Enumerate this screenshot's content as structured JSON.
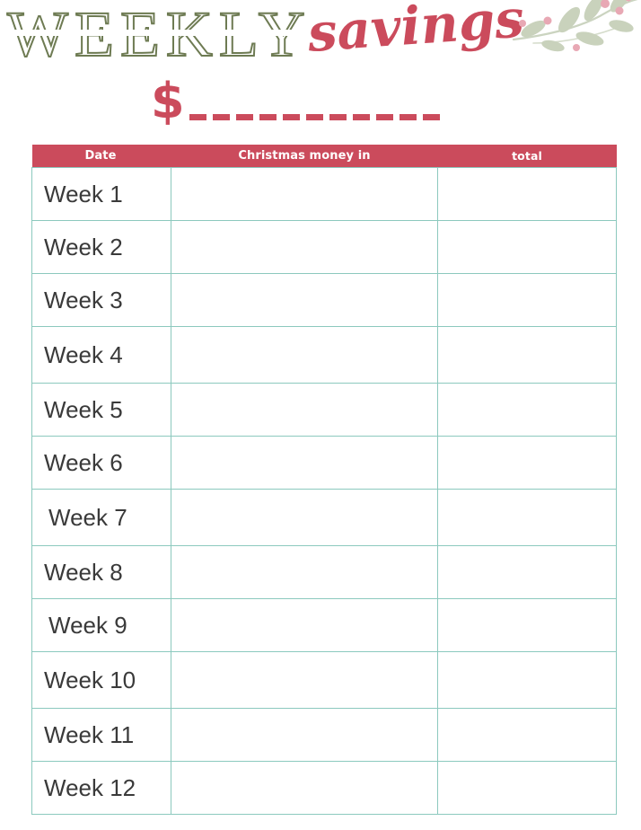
{
  "page": {
    "title_primary": "WEEKLY",
    "title_script": "savings",
    "currency_symbol": "$",
    "amount_blank_dashes": 11
  },
  "decoration": {
    "name": "botanical-branch",
    "leaf_color": "#C9D2BC",
    "stem_color": "#CBD4C0",
    "berry_color": "#E8A8B4"
  },
  "colors": {
    "accent_red": "#CB4B5C",
    "olive_green": "#6E7B53",
    "table_border_teal": "#8CC9BE",
    "text_dark": "#3A3A3A",
    "background": "#FFFFFF"
  },
  "table": {
    "headers": {
      "date": "Date",
      "money_in": "Christmas money in",
      "total": "total"
    },
    "rows": [
      {
        "date": "Week 1",
        "money_in": "",
        "total": ""
      },
      {
        "date": "Week 2",
        "money_in": "",
        "total": ""
      },
      {
        "date": "Week 3",
        "money_in": "",
        "total": ""
      },
      {
        "date": "Week 4",
        "money_in": "",
        "total": ""
      },
      {
        "date": "Week 5",
        "money_in": "",
        "total": ""
      },
      {
        "date": "Week 6",
        "money_in": "",
        "total": ""
      },
      {
        "date": "Week 7",
        "money_in": "",
        "total": ""
      },
      {
        "date": "Week 8",
        "money_in": "",
        "total": ""
      },
      {
        "date": "Week 9",
        "money_in": "",
        "total": ""
      },
      {
        "date": "Week 10",
        "money_in": "",
        "total": ""
      },
      {
        "date": "Week 11",
        "money_in": "",
        "total": ""
      },
      {
        "date": "Week 12",
        "money_in": "",
        "total": ""
      }
    ]
  }
}
